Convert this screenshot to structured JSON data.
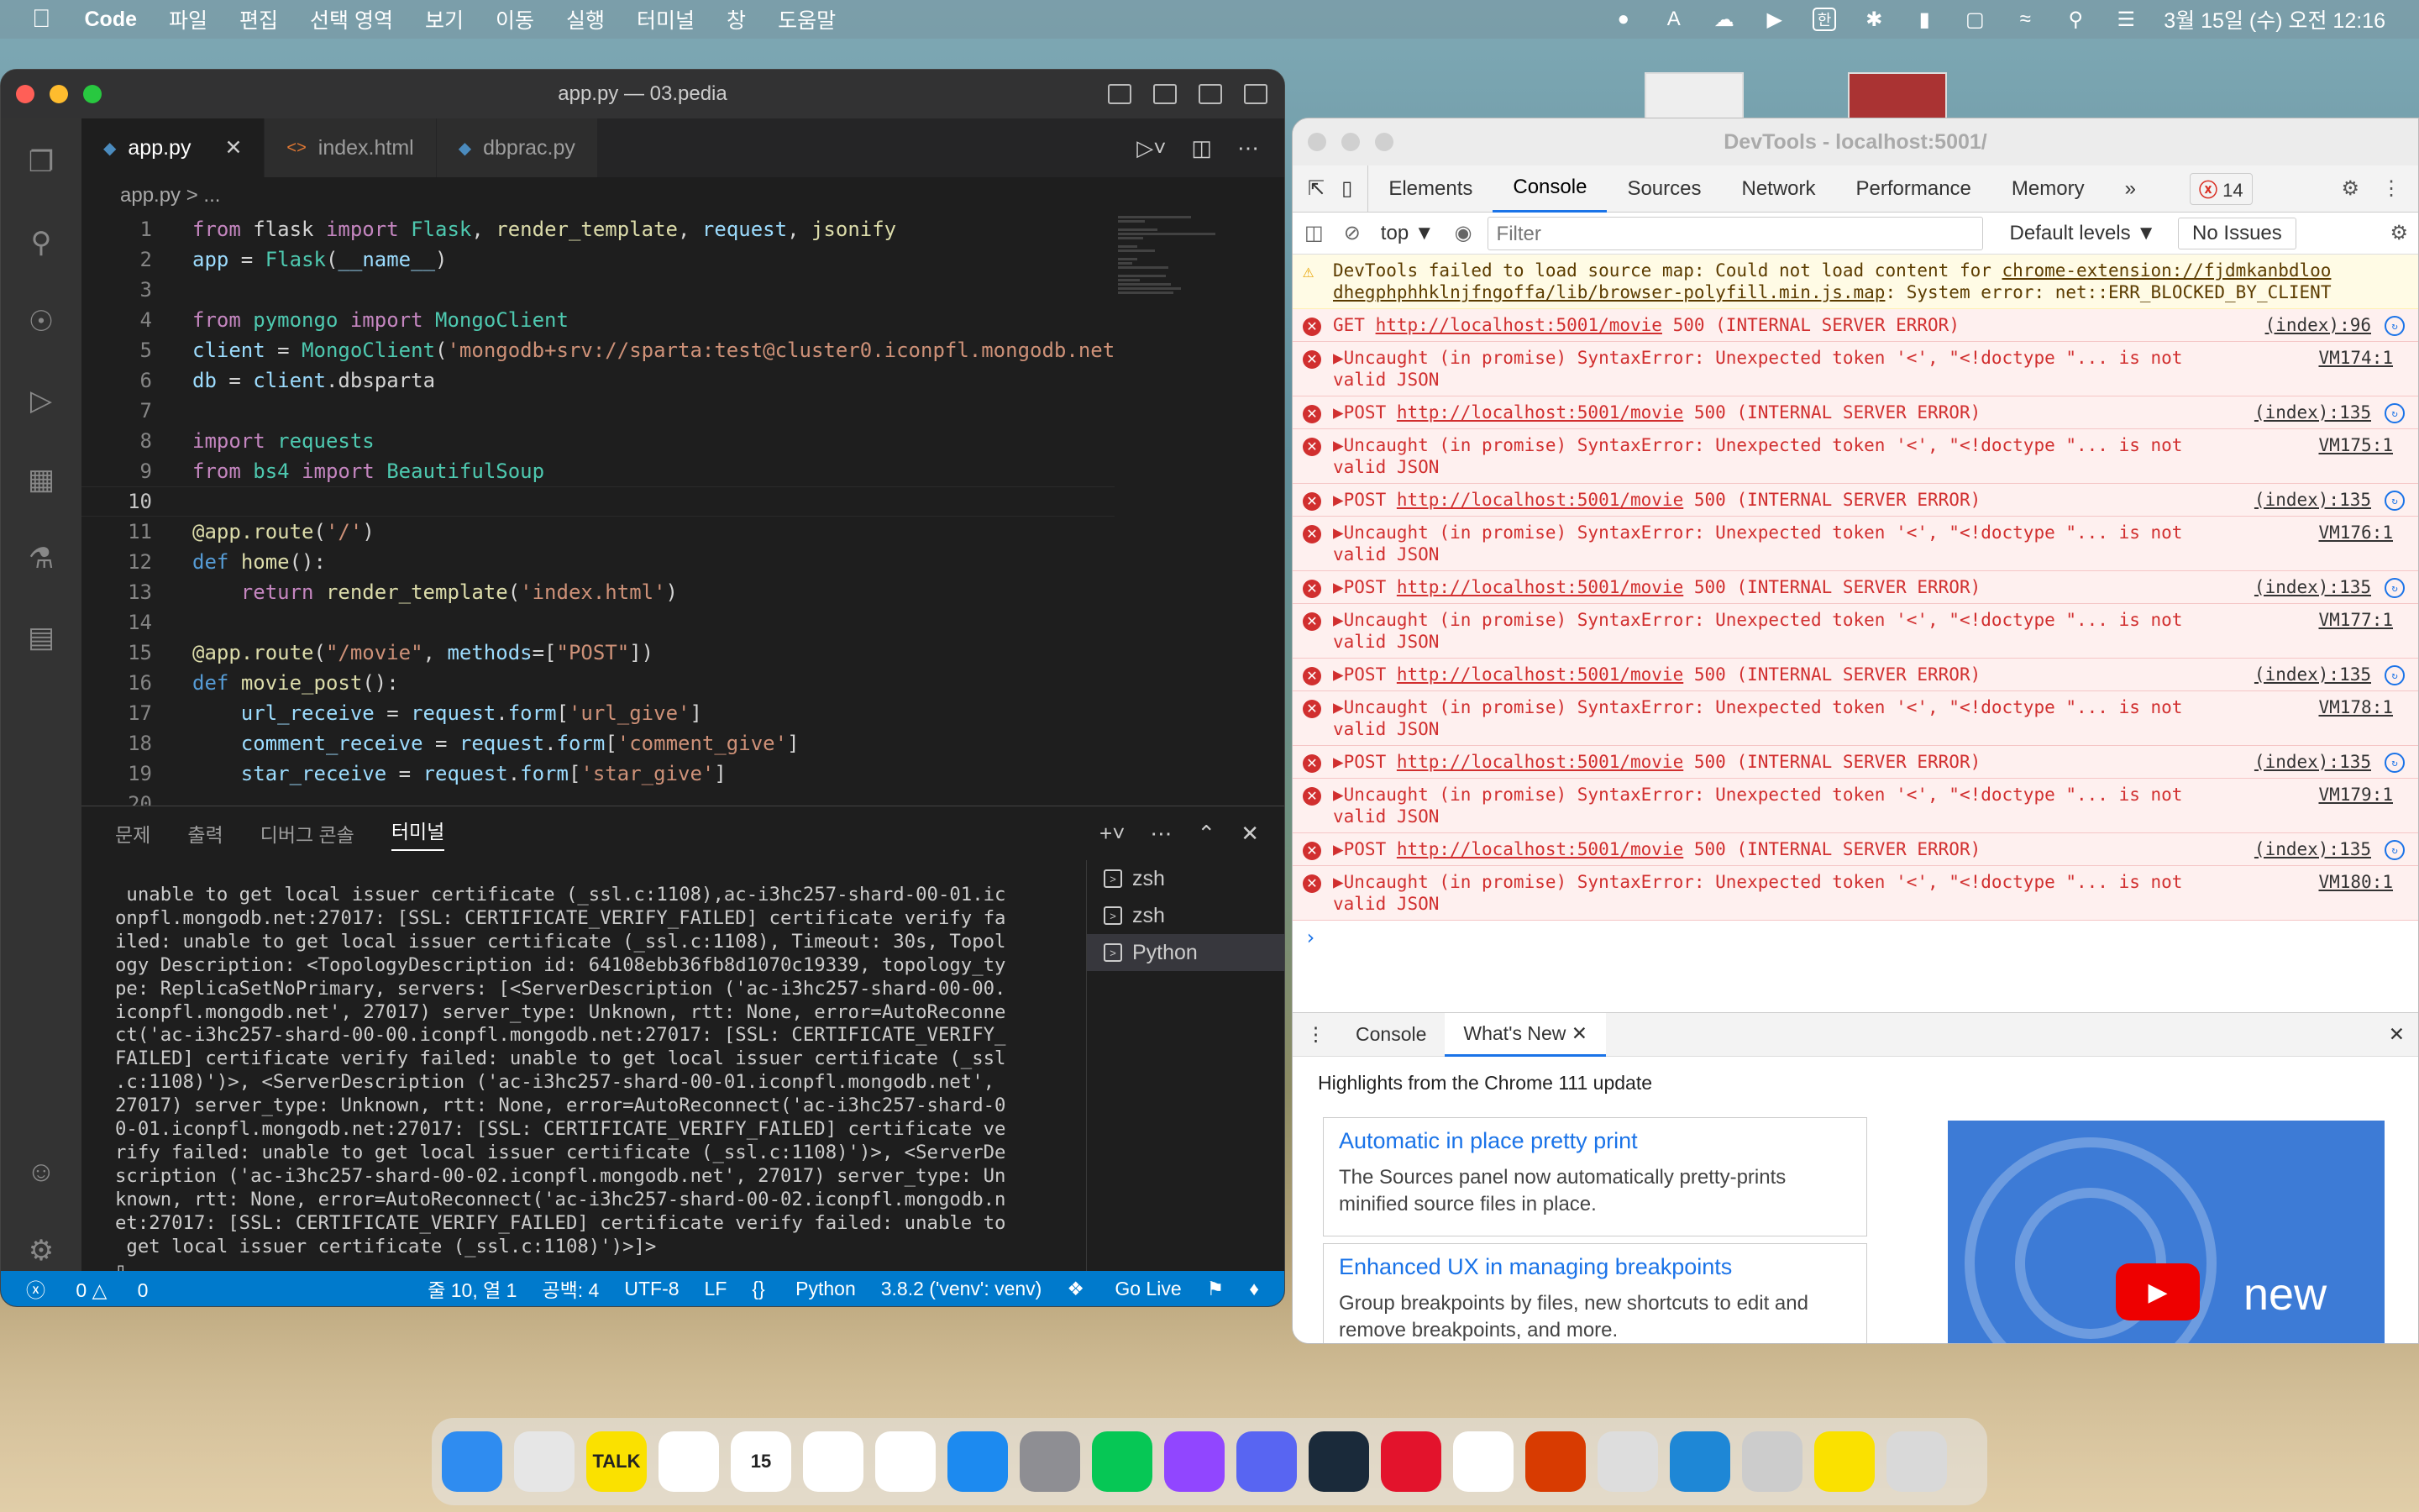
{
  "menubar": {
    "app": "Code",
    "items": [
      "파일",
      "편집",
      "선택 영역",
      "보기",
      "이동",
      "실행",
      "터미널",
      "창",
      "도움말"
    ],
    "datetime": "3월 15일 (수) 오전 12:16",
    "input_lang": "한"
  },
  "vscode": {
    "title": "app.py — 03.pedia",
    "tabs": [
      {
        "label": "app.py",
        "icon": "python"
      },
      {
        "label": "index.html",
        "icon": "html"
      },
      {
        "label": "dbprac.py",
        "icon": "python"
      }
    ],
    "breadcrumb": "app.py > ...",
    "code_lines": [
      {
        "n": "1",
        "html": "<span class='kw'>from</span> flask <span class='kw'>import</span> <span class='cls'>Flask</span>, <span class='fn'>render_template</span>, <span class='var'>request</span>, <span class='fn'>jsonify</span>"
      },
      {
        "n": "2",
        "html": "<span class='var'>app</span> = <span class='cls'>Flask</span>(<span class='var'>__name__</span>)"
      },
      {
        "n": "3",
        "html": ""
      },
      {
        "n": "4",
        "html": "<span class='kw'>from</span> <span class='cls'>pymongo</span> <span class='kw'>import</span> <span class='cls'>MongoClient</span>"
      },
      {
        "n": "5",
        "html": "<span class='var'>client</span> = <span class='cls'>MongoClient</span>(<span class='str'>'mongodb+srv://sparta:test@cluster0.iconpfl.mongodb.net/</span>"
      },
      {
        "n": "6",
        "html": "<span class='var'>db</span> = <span class='var'>client</span>.dbsparta"
      },
      {
        "n": "7",
        "html": ""
      },
      {
        "n": "8",
        "html": "<span class='kw'>import</span> <span class='cls'>requests</span>"
      },
      {
        "n": "9",
        "html": "<span class='kw'>from</span> <span class='cls'>bs4</span> <span class='kw'>import</span> <span class='cls'>BeautifulSoup</span>"
      },
      {
        "n": "10",
        "html": "",
        "cur": true
      },
      {
        "n": "11",
        "html": "<span class='dec'>@app.route</span>(<span class='str'>'/'</span>)"
      },
      {
        "n": "12",
        "html": "<span class='kw2'>def</span> <span class='fn'>home</span>():"
      },
      {
        "n": "13",
        "html": "    <span class='kw'>return</span> <span class='fn'>render_template</span>(<span class='str'>'index.html'</span>)"
      },
      {
        "n": "14",
        "html": ""
      },
      {
        "n": "15",
        "html": "<span class='dec'>@app.route</span>(<span class='str'>\"/movie\"</span>, <span class='var'>methods</span>=[<span class='str'>\"POST\"</span>])"
      },
      {
        "n": "16",
        "html": "<span class='kw2'>def</span> <span class='fn'>movie_post</span>():"
      },
      {
        "n": "17",
        "html": "    <span class='var'>url_receive</span> = <span class='var'>request</span>.<span class='var'>form</span>[<span class='str'>'url_give'</span>]"
      },
      {
        "n": "18",
        "html": "    <span class='var'>comment_receive</span> = <span class='var'>request</span>.<span class='var'>form</span>[<span class='str'>'comment_give'</span>]"
      },
      {
        "n": "19",
        "html": "    <span class='var'>star_receive</span> = <span class='var'>request</span>.<span class='var'>form</span>[<span class='str'>'star_give'</span>]"
      },
      {
        "n": "20",
        "html": ""
      }
    ],
    "panel_tabs": [
      "문제",
      "출력",
      "디버그 콘솔",
      "터미널"
    ],
    "terminal_text": " unable to get local issuer certificate (_ssl.c:1108),ac-i3hc257-shard-00-01.ic\nonpfl.mongodb.net:27017: [SSL: CERTIFICATE_VERIFY_FAILED] certificate verify fa\niled: unable to get local issuer certificate (_ssl.c:1108), Timeout: 30s, Topol\nogy Description: <TopologyDescription id: 64108ebb36fb8d1070c19339, topology_ty\npe: ReplicaSetNoPrimary, servers: [<ServerDescription ('ac-i3hc257-shard-00-00.\niconpfl.mongodb.net', 27017) server_type: Unknown, rtt: None, error=AutoReconne\nct('ac-i3hc257-shard-00-00.iconpfl.mongodb.net:27017: [SSL: CERTIFICATE_VERIFY_\nFAILED] certificate verify failed: unable to get local issuer certificate (_ssl\n.c:1108)')>, <ServerDescription ('ac-i3hc257-shard-00-01.iconpfl.mongodb.net',\n27017) server_type: Unknown, rtt: None, error=AutoReconnect('ac-i3hc257-shard-0\n0-01.iconpfl.mongodb.net:27017: [SSL: CERTIFICATE_VERIFY_FAILED] certificate ve\nrify failed: unable to get local issuer certificate (_ssl.c:1108)')>, <ServerDe\nscription ('ac-i3hc257-shard-00-02.iconpfl.mongodb.net', 27017) server_type: Un\nknown, rtt: None, error=AutoReconnect('ac-i3hc257-shard-00-02.iconpfl.mongodb.n\net:27017: [SSL: CERTIFICATE_VERIFY_FAILED] certificate verify failed: unable to\n get local issuer certificate (_ssl.c:1108)')>]>\n▯",
    "terminals": [
      "zsh",
      "zsh",
      "Python"
    ],
    "status": {
      "errors": "0",
      "warnings": "0",
      "position": "줄 10, 열 1",
      "spaces": "공백: 4",
      "encoding": "UTF-8",
      "eol": "LF",
      "lang": "Python",
      "interpreter": "3.8.2 ('venv': venv)",
      "golive": "Go Live"
    }
  },
  "devtools": {
    "title": "DevTools - localhost:5001/",
    "tabs": [
      "Elements",
      "Console",
      "Sources",
      "Network",
      "Performance",
      "Memory"
    ],
    "more": "»",
    "error_count": "14",
    "context": "top ▼",
    "filter_placeholder": "Filter",
    "levels": "Default levels ▼",
    "issues": "No Issues",
    "warning": {
      "text1": "DevTools failed to load source map: Could not load content for ",
      "link1": "chrome-extension://fjdmkanbdloo",
      "link2": "dhegphphhklnjfngoffa/lib/browser-polyfill.min.js.map",
      "text2": ": System error: net::ERR_BLOCKED_BY_CLIENT"
    },
    "messages": [
      {
        "kind": "net",
        "method": "GET",
        "url": "http://localhost:5001/movie",
        "status": "500 (INTERNAL SERVER ERROR)",
        "src": "(index):96"
      },
      {
        "kind": "js",
        "text": "▶Uncaught (in promise) SyntaxError: Unexpected token '<', \"<!doctype \"... is not",
        "text2": "valid JSON",
        "src": "VM174:1"
      },
      {
        "kind": "net",
        "method": "▶POST",
        "url": "http://localhost:5001/movie",
        "status": "500 (INTERNAL SERVER ERROR)",
        "src": "(index):135"
      },
      {
        "kind": "js",
        "text": "▶Uncaught (in promise) SyntaxError: Unexpected token '<', \"<!doctype \"... is not",
        "text2": "valid JSON",
        "src": "VM175:1"
      },
      {
        "kind": "net",
        "method": "▶POST",
        "url": "http://localhost:5001/movie",
        "status": "500 (INTERNAL SERVER ERROR)",
        "src": "(index):135"
      },
      {
        "kind": "js",
        "text": "▶Uncaught (in promise) SyntaxError: Unexpected token '<', \"<!doctype \"... is not",
        "text2": "valid JSON",
        "src": "VM176:1"
      },
      {
        "kind": "net",
        "method": "▶POST",
        "url": "http://localhost:5001/movie",
        "status": "500 (INTERNAL SERVER ERROR)",
        "src": "(index):135"
      },
      {
        "kind": "js",
        "text": "▶Uncaught (in promise) SyntaxError: Unexpected token '<', \"<!doctype \"... is not",
        "text2": "valid JSON",
        "src": "VM177:1"
      },
      {
        "kind": "net",
        "method": "▶POST",
        "url": "http://localhost:5001/movie",
        "status": "500 (INTERNAL SERVER ERROR)",
        "src": "(index):135"
      },
      {
        "kind": "js",
        "text": "▶Uncaught (in promise) SyntaxError: Unexpected token '<', \"<!doctype \"... is not",
        "text2": "valid JSON",
        "src": "VM178:1"
      },
      {
        "kind": "net",
        "method": "▶POST",
        "url": "http://localhost:5001/movie",
        "status": "500 (INTERNAL SERVER ERROR)",
        "src": "(index):135"
      },
      {
        "kind": "js",
        "text": "▶Uncaught (in promise) SyntaxError: Unexpected token '<', \"<!doctype \"... is not",
        "text2": "valid JSON",
        "src": "VM179:1"
      },
      {
        "kind": "net",
        "method": "▶POST",
        "url": "http://localhost:5001/movie",
        "status": "500 (INTERNAL SERVER ERROR)",
        "src": "(index):135"
      },
      {
        "kind": "js",
        "text": "▶Uncaught (in promise) SyntaxError: Unexpected token '<', \"<!doctype \"... is not",
        "text2": "valid JSON",
        "src": "VM180:1"
      }
    ],
    "prompt": "›",
    "drawer": {
      "tabs": [
        "Console",
        "What's New"
      ],
      "headline": "Highlights from the Chrome 111 update",
      "cards": [
        {
          "title": "Automatic in place pretty print",
          "body": "The Sources panel now automatically pretty-prints minified source files in place."
        },
        {
          "title": "Enhanced UX in managing breakpoints",
          "body": "Group breakpoints by files, new shortcuts to edit and remove breakpoints, and more."
        }
      ],
      "video_label": "new"
    }
  },
  "dock": [
    {
      "name": "finder",
      "color": "#2f8cf0",
      "label": ""
    },
    {
      "name": "launchpad",
      "color": "#e6e6e6",
      "label": ""
    },
    {
      "name": "kakaotalk",
      "color": "#fae100",
      "label": "TALK"
    },
    {
      "name": "chrome",
      "color": "#ffffff",
      "label": ""
    },
    {
      "name": "calendar",
      "color": "#ffffff",
      "label": "15"
    },
    {
      "name": "notes",
      "color": "#ffffff",
      "label": ""
    },
    {
      "name": "freeform",
      "color": "#ffffff",
      "label": ""
    },
    {
      "name": "app-store",
      "color": "#1c8af0",
      "label": ""
    },
    {
      "name": "system-settings",
      "color": "#8e8e93",
      "label": ""
    },
    {
      "name": "line",
      "color": "#06c755",
      "label": ""
    },
    {
      "name": "twitch",
      "color": "#9146ff",
      "label": ""
    },
    {
      "name": "discord",
      "color": "#5865f2",
      "label": ""
    },
    {
      "name": "league",
      "color": "#1a2a3a",
      "label": ""
    },
    {
      "name": "red-app",
      "color": "#e3132c",
      "label": ""
    },
    {
      "name": "photos",
      "color": "#ffffff",
      "label": ""
    },
    {
      "name": "office",
      "color": "#d83b01",
      "label": ""
    },
    {
      "name": "app-cat",
      "color": "#dddddd",
      "label": ""
    },
    {
      "name": "vscode",
      "color": "#1e87d6",
      "label": ""
    },
    {
      "name": "preview",
      "color": "#cccccc",
      "label": ""
    },
    {
      "name": "kakao-doc",
      "color": "#fae100",
      "label": ""
    },
    {
      "name": "trash",
      "color": "#d9d9d9",
      "label": ""
    }
  ]
}
